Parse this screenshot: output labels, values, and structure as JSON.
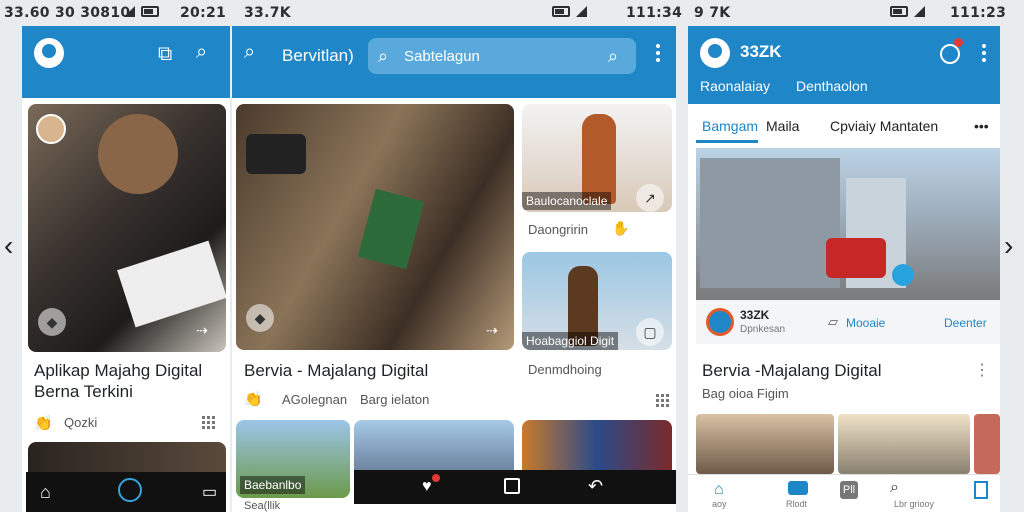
{
  "status": {
    "left_time": "33.60 30 30810",
    "left_time2": "20:21",
    "mid_time": "33.7K",
    "mid_time2": "",
    "right_time": "111:34",
    "right_left": "9 7K",
    "right_time2": "111:23"
  },
  "panel1": {
    "caption_line1": "Aplikap Majahg Digital",
    "caption_line2": "Berna Terkini",
    "meta": "Qozki"
  },
  "panel2": {
    "search_label": "Bervitlan)",
    "search_placeholder": "Sabtelagun",
    "main_caption": "Bervia - Majalang Digital",
    "main_meta_a": "AGolegnan",
    "main_meta_b": "Barg ielaton",
    "side1_tag": "Baulocanoclale",
    "side1_meta": "Daongririn",
    "side2_tag": "Hoabaggiol Digit",
    "side2_meta": "Denmdhoing",
    "bottom_tag": "Baebanlbo",
    "bottom_caption": "Sea(llik"
  },
  "panel3": {
    "title": "33ZK",
    "sub_a": "Raonalaiay",
    "sub_b": "Denthaolon",
    "tabs": [
      "Bamgam",
      "Maila",
      "Cpviaiy Mantaten"
    ],
    "card_brand": "33ZK",
    "card_sub": "Dpnkesan",
    "card_action": "Mooaie",
    "card_follow": "Deenter",
    "caption": "Bervia -Majalang Digital",
    "meta": "Bag oioa Figim",
    "bottom_nav": [
      "aoy",
      "Rlodt",
      "Pll",
      "Lbr griooy",
      ""
    ]
  },
  "colors": {
    "brand": "#1f87c8",
    "search": "#5aa9dc",
    "nav": "#111111"
  }
}
